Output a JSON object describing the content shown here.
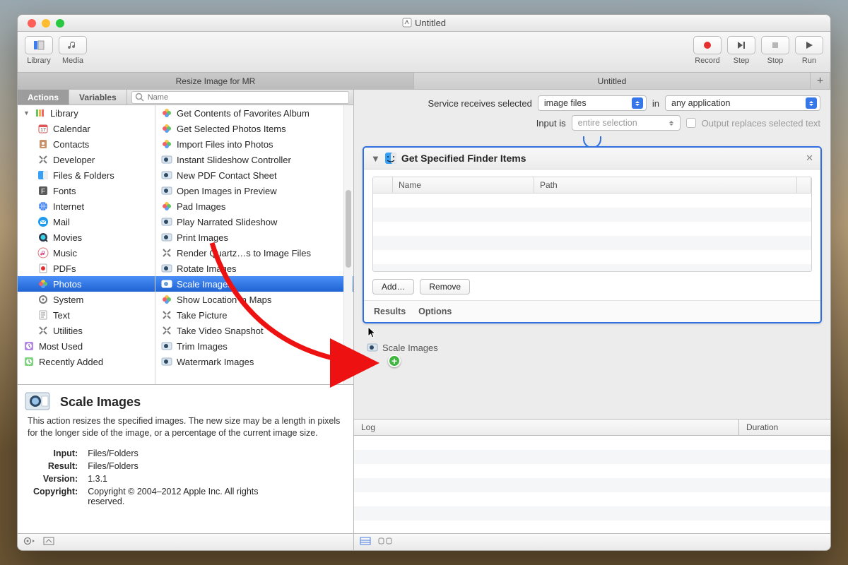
{
  "window": {
    "title": "Untitled"
  },
  "toolbar": {
    "library": "Library",
    "media": "Media",
    "record": "Record",
    "step": "Step",
    "stop": "Stop",
    "run": "Run"
  },
  "tabs": {
    "left": "Resize Image for MR",
    "right": "Untitled"
  },
  "subtabs": {
    "actions": "Actions",
    "variables": "Variables"
  },
  "search": {
    "placeholder": "Name"
  },
  "categories": {
    "root": {
      "label": "Library",
      "expanded": true
    },
    "items": [
      {
        "label": "Calendar",
        "icon": "calendar"
      },
      {
        "label": "Contacts",
        "icon": "contacts"
      },
      {
        "label": "Developer",
        "icon": "tools"
      },
      {
        "label": "Files & Folders",
        "icon": "finder"
      },
      {
        "label": "Fonts",
        "icon": "fontbook"
      },
      {
        "label": "Internet",
        "icon": "globe"
      },
      {
        "label": "Mail",
        "icon": "mail"
      },
      {
        "label": "Movies",
        "icon": "quicktime"
      },
      {
        "label": "Music",
        "icon": "itunes"
      },
      {
        "label": "PDFs",
        "icon": "pdf"
      },
      {
        "label": "Photos",
        "icon": "photos",
        "selected": true
      },
      {
        "label": "System",
        "icon": "gear"
      },
      {
        "label": "Text",
        "icon": "text"
      },
      {
        "label": "Utilities",
        "icon": "tools"
      }
    ],
    "extra": [
      {
        "label": "Most Used",
        "icon": "clock-purple"
      },
      {
        "label": "Recently Added",
        "icon": "clock-green"
      }
    ]
  },
  "actions": [
    {
      "label": "Get Contents of Favorites Album",
      "icon": "photos"
    },
    {
      "label": "Get Selected Photos Items",
      "icon": "photos"
    },
    {
      "label": "Import Files into Photos",
      "icon": "photos"
    },
    {
      "label": "Instant Slideshow Controller",
      "icon": "preview"
    },
    {
      "label": "New PDF Contact Sheet",
      "icon": "preview"
    },
    {
      "label": "Open Images in Preview",
      "icon": "preview"
    },
    {
      "label": "Pad Images",
      "icon": "photos"
    },
    {
      "label": "Play Narrated Slideshow",
      "icon": "preview"
    },
    {
      "label": "Print Images",
      "icon": "preview"
    },
    {
      "label": "Render Quartz…s to Image Files",
      "icon": "tools"
    },
    {
      "label": "Rotate Images",
      "icon": "preview"
    },
    {
      "label": "Scale Images",
      "icon": "preview",
      "selected": true
    },
    {
      "label": "Show Location in Maps",
      "icon": "photos"
    },
    {
      "label": "Take Picture",
      "icon": "tools"
    },
    {
      "label": "Take Video Snapshot",
      "icon": "tools"
    },
    {
      "label": "Trim Images",
      "icon": "preview"
    },
    {
      "label": "Watermark Images",
      "icon": "preview"
    }
  ],
  "info": {
    "title": "Scale Images",
    "desc": "This action resizes the specified images. The new size may be a length in pixels for the longer side of the image, or a percentage of the current image size.",
    "rows": {
      "input_k": "Input:",
      "input_v": "Files/Folders",
      "result_k": "Result:",
      "result_v": "Files/Folders",
      "version_k": "Version:",
      "version_v": "1.3.1",
      "copyright_k": "Copyright:",
      "copyright_v": "Copyright © 2004–2012 Apple Inc.  All rights reserved."
    }
  },
  "service": {
    "receives_label": "Service receives selected",
    "receives_value": "image files",
    "in_label": "in",
    "in_value": "any application",
    "inputis_label": "Input is",
    "inputis_value": "entire selection",
    "replace_label": "Output replaces selected text"
  },
  "workflow": {
    "card_title": "Get Specified Finder Items",
    "cols": {
      "name": "Name",
      "path": "Path"
    },
    "add": "Add…",
    "remove": "Remove",
    "results": "Results",
    "options": "Options",
    "drag_label": "Scale Images"
  },
  "log": {
    "col_log": "Log",
    "col_duration": "Duration"
  }
}
